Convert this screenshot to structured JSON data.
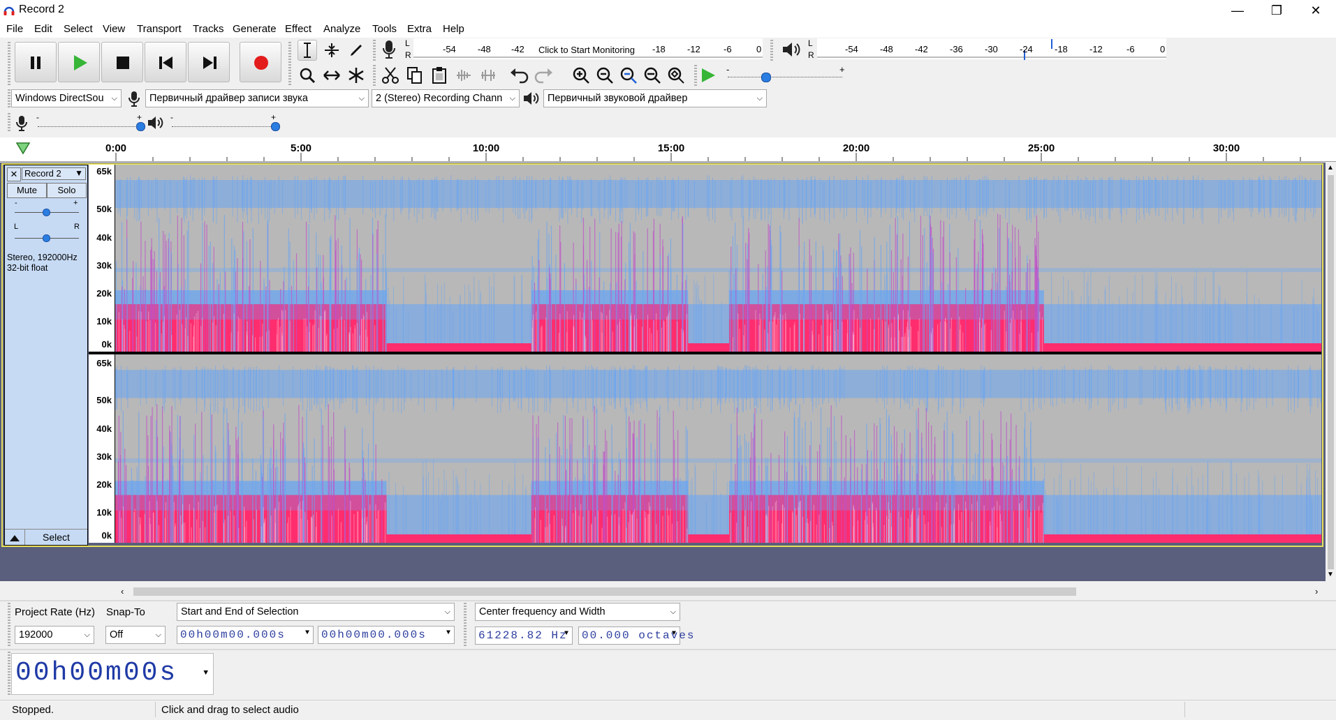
{
  "window": {
    "title": "Record 2",
    "minimize": "—",
    "maximize": "❐",
    "close": "✕"
  },
  "menu": [
    "File",
    "Edit",
    "Select",
    "View",
    "Transport",
    "Tracks",
    "Generate",
    "Effect",
    "Analyze",
    "Tools",
    "Extra",
    "Help"
  ],
  "colors": {
    "accent": "#1f5fd6",
    "record": "#e31b1b",
    "play": "#2db82d",
    "spectro_pink": "#ff2d6e",
    "spectro_blue": "#6aa5f2",
    "track_bg": "#c6daf4"
  },
  "meters": {
    "record_scale": [
      "-54",
      "-48",
      "-42",
      "Click to Start Monitoring",
      "-18",
      "-12",
      "-6",
      "0"
    ],
    "play_scale": [
      "-54",
      "-48",
      "-42",
      "-36",
      "-30",
      "-24",
      "-18",
      "-12",
      "-6",
      "0"
    ],
    "lr": [
      "L",
      "R"
    ]
  },
  "device": {
    "host": "Windows DirectSou",
    "rec_device": "Первичный драйвер записи звука",
    "channels": "2 (Stereo) Recording Chann",
    "play_device": "Первичный звуковой драйвер"
  },
  "slider_signs": {
    "minus": "-",
    "plus": "+"
  },
  "ruler": {
    "ticks": [
      "0:00",
      "5:00",
      "10:00",
      "15:00",
      "20:00",
      "25:00",
      "30:00"
    ]
  },
  "track": {
    "name": "Record 2",
    "mute": "Mute",
    "solo": "Solo",
    "pan_left": "L",
    "pan_right": "R",
    "info": "Stereo, 192000Hz\n32-bit float",
    "select": "Select",
    "freq_labels": [
      "65k",
      "50k",
      "40k",
      "30k",
      "20k",
      "10k",
      "0k"
    ]
  },
  "selection_bar": {
    "project_rate_label": "Project Rate (Hz)",
    "project_rate": "192000",
    "snap_label": "Snap-To",
    "snap_value": "Off",
    "selection_mode": "Start and End of Selection",
    "start": "00h00m00.000s",
    "end": "00h00m00.000s"
  },
  "spectral_bar": {
    "mode": "Center frequency and Width",
    "center": "61228.82 Hz",
    "width": "00.000 octaves"
  },
  "time_display": "00h00m00s",
  "status": {
    "state": "Stopped.",
    "hint": "Click and drag to select audio"
  }
}
